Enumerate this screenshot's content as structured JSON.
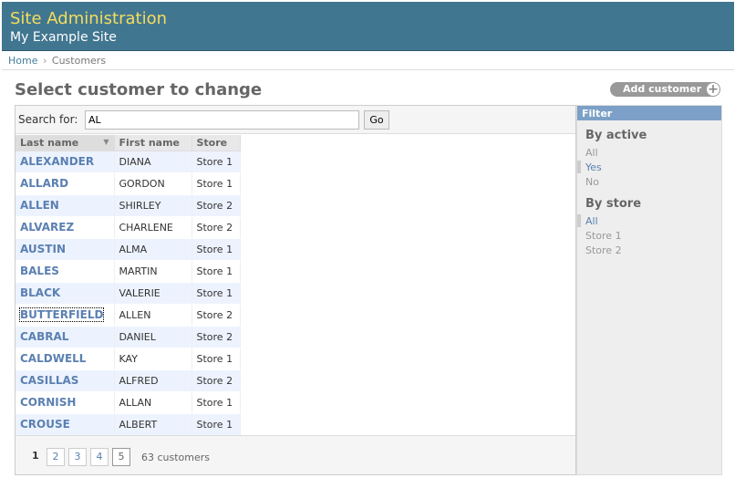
{
  "header": {
    "title": "Site Administration",
    "subtitle": "My Example Site"
  },
  "breadcrumb": {
    "home": "Home",
    "separator": "›",
    "current": "Customers"
  },
  "page_title": "Select customer to change",
  "add_button": {
    "label": "Add customer",
    "icon": "+"
  },
  "search": {
    "label": "Search for:",
    "value": "AL",
    "button": "Go"
  },
  "table": {
    "headers": [
      "Last name",
      "First name",
      "Store"
    ],
    "sorted_column": "Last name",
    "rows": [
      {
        "last": "ALEXANDER",
        "first": "DIANA",
        "store": "Store 1"
      },
      {
        "last": "ALLARD",
        "first": "GORDON",
        "store": "Store 1"
      },
      {
        "last": "ALLEN",
        "first": "SHIRLEY",
        "store": "Store 2"
      },
      {
        "last": "ALVAREZ",
        "first": "CHARLENE",
        "store": "Store 2"
      },
      {
        "last": "AUSTIN",
        "first": "ALMA",
        "store": "Store 1"
      },
      {
        "last": "BALES",
        "first": "MARTIN",
        "store": "Store 1"
      },
      {
        "last": "BLACK",
        "first": "VALERIE",
        "store": "Store 1"
      },
      {
        "last": "BUTTERFIELD",
        "first": "ALLEN",
        "store": "Store 2"
      },
      {
        "last": "CABRAL",
        "first": "DANIEL",
        "store": "Store 2"
      },
      {
        "last": "CALDWELL",
        "first": "KAY",
        "store": "Store 1"
      },
      {
        "last": "CASILLAS",
        "first": "ALFRED",
        "store": "Store 2"
      },
      {
        "last": "CORNISH",
        "first": "ALLAN",
        "store": "Store 1"
      },
      {
        "last": "CROUSE",
        "first": "ALBERT",
        "store": "Store 1"
      }
    ]
  },
  "pagination": {
    "current": "1",
    "pages": [
      "2",
      "3",
      "4",
      "5"
    ],
    "count": "63 customers"
  },
  "filter": {
    "title": "Filter",
    "groups": [
      {
        "title": "By active",
        "options": [
          "All",
          "Yes",
          "No"
        ],
        "selected": "Yes"
      },
      {
        "title": "By store",
        "options": [
          "All",
          "Store 1",
          "Store 2"
        ],
        "selected": "All"
      }
    ]
  },
  "colors": {
    "header_bg": "#417690",
    "title_yellow": "#f5dd5d",
    "link_blue": "#5b80b2",
    "filter_head": "#7ca0c7"
  }
}
